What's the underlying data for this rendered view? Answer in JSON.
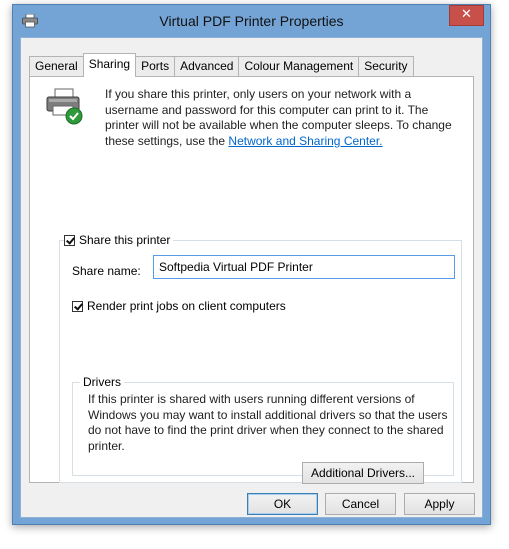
{
  "window": {
    "title": "Virtual PDF Printer Properties",
    "close_symbol": "✕"
  },
  "tabs": [
    {
      "label": "General"
    },
    {
      "label": "Sharing",
      "active": true
    },
    {
      "label": "Ports"
    },
    {
      "label": "Advanced"
    },
    {
      "label": "Colour Management"
    },
    {
      "label": "Security"
    }
  ],
  "sharing": {
    "intro_text": "If you share this printer, only users on your network with a username and password for this computer can print to it. The printer will not be available when the computer sleeps. To change these settings, use the ",
    "intro_link": "Network and Sharing Center.",
    "share_printer_label": "Share this printer",
    "share_printer_checked": true,
    "share_name_label": "Share name:",
    "share_name_value": "Softpedia Virtual PDF Printer",
    "render_label": "Render print jobs on client computers",
    "render_checked": true,
    "drivers": {
      "legend": "Drivers",
      "text": "If this printer is shared with users running different versions of Windows you may want to install additional drivers so that the users do not have to find the print driver when they connect to the shared printer.",
      "button_label": "Additional Drivers..."
    }
  },
  "footer": {
    "ok_label": "OK",
    "cancel_label": "Cancel",
    "apply_label": "Apply"
  },
  "icons": {
    "title": "printer-icon",
    "shared_printer": "shared-printer-icon"
  },
  "colors": {
    "frame": "#74a4d6",
    "close": "#c7504b",
    "link": "#0066cc",
    "input_border": "#569de5"
  }
}
